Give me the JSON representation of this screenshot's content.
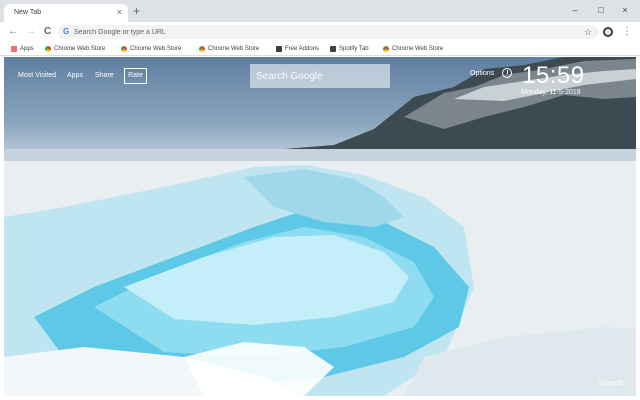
{
  "browser": {
    "tab_title": "New Tab",
    "tab_close": "×",
    "new_tab": "+",
    "controls": {
      "minimize": "–",
      "maximize": "□",
      "close": "×"
    },
    "nav": {
      "back": "←",
      "forward": "→",
      "reload": "C"
    },
    "omnibox": {
      "placeholder": "Search Google or type a URL",
      "g_glyph": "G"
    },
    "star": "☆",
    "menu": "⋮"
  },
  "bookmarks": [
    {
      "label": "Apps",
      "icon": "apps-grid-icon"
    },
    {
      "label": "Chrome Web Store",
      "icon": "chrome-web-store-icon"
    },
    {
      "label": "Chrome Web Store",
      "icon": "chrome-web-store-icon"
    },
    {
      "label": "Chrome Web Store",
      "icon": "chrome-web-store-icon"
    },
    {
      "label": "Free Addons",
      "icon": "free-addons-icon"
    },
    {
      "label": "Spotify Tab",
      "icon": "spotify-tab-icon"
    },
    {
      "label": "Chrome Web Store",
      "icon": "chrome-web-store-icon"
    }
  ],
  "newtab": {
    "links": {
      "most_visited": "Most Visited",
      "apps": "Apps",
      "share": "Share",
      "rate": "Rate"
    },
    "search_placeholder": "Search Google",
    "options": "Options",
    "time": "15:59",
    "date": "Monday, 11-5-2018",
    "support": "Support"
  },
  "colors": {
    "chrome_frame": "#dee1e6",
    "omnibox_bg": "#f1f3f4",
    "ice_blue": "#5ec9e6"
  }
}
